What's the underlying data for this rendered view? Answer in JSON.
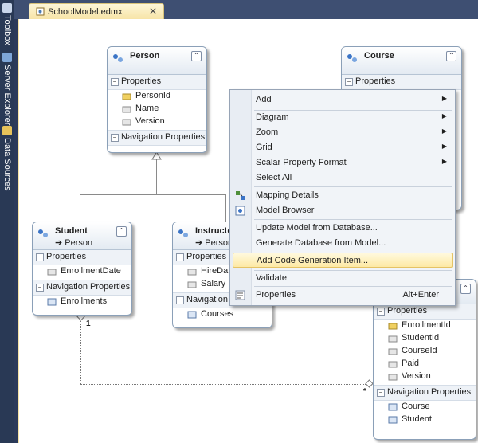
{
  "dock": {
    "toolbox": "Toolbox",
    "server_explorer": "Server Explorer",
    "data_sources": "Data Sources"
  },
  "tab": {
    "title": "SchoolModel.edmx",
    "close": "✕"
  },
  "entities": {
    "person": {
      "name": "Person",
      "properties_label": "Properties",
      "properties": [
        "PersonId",
        "Name",
        "Version"
      ],
      "nav_label": "Navigation Properties",
      "nav": []
    },
    "course": {
      "name": "Course",
      "properties_label": "Properties"
    },
    "student": {
      "name": "Student",
      "base": "➔ Person",
      "properties_label": "Properties",
      "properties": [
        "EnrollmentDate"
      ],
      "nav_label": "Navigation Properties",
      "nav": [
        "Enrollments"
      ]
    },
    "instructor": {
      "name": "Instructor",
      "base": "➔ Person",
      "properties_label": "Properties",
      "properties": [
        "HireDate",
        "Salary"
      ],
      "nav_label": "Navigation P",
      "nav": [
        "Courses"
      ]
    },
    "enrollment": {
      "properties_label": "Properties",
      "properties": [
        "EnrollmentId",
        "StudentId",
        "CourseId",
        "Paid",
        "Version"
      ],
      "nav_label": "Navigation Properties",
      "nav": [
        "Course",
        "Student"
      ]
    }
  },
  "association": {
    "end1": "1",
    "end2": "*"
  },
  "menu": {
    "add": "Add",
    "diagram": "Diagram",
    "zoom": "Zoom",
    "grid": "Grid",
    "scalar_format": "Scalar Property Format",
    "select_all": "Select All",
    "mapping_details": "Mapping Details",
    "model_browser": "Model Browser",
    "update_model": "Update Model from Database...",
    "generate_db": "Generate Database from Model...",
    "add_code_gen": "Add Code Generation Item...",
    "validate": "Validate",
    "properties": "Properties",
    "properties_shortcut": "Alt+Enter",
    "submenu_arrow": "▶"
  },
  "colors": {
    "accent": "#f7e4a6",
    "menu_highlight": "#fde9a4",
    "dock": "#293955"
  }
}
